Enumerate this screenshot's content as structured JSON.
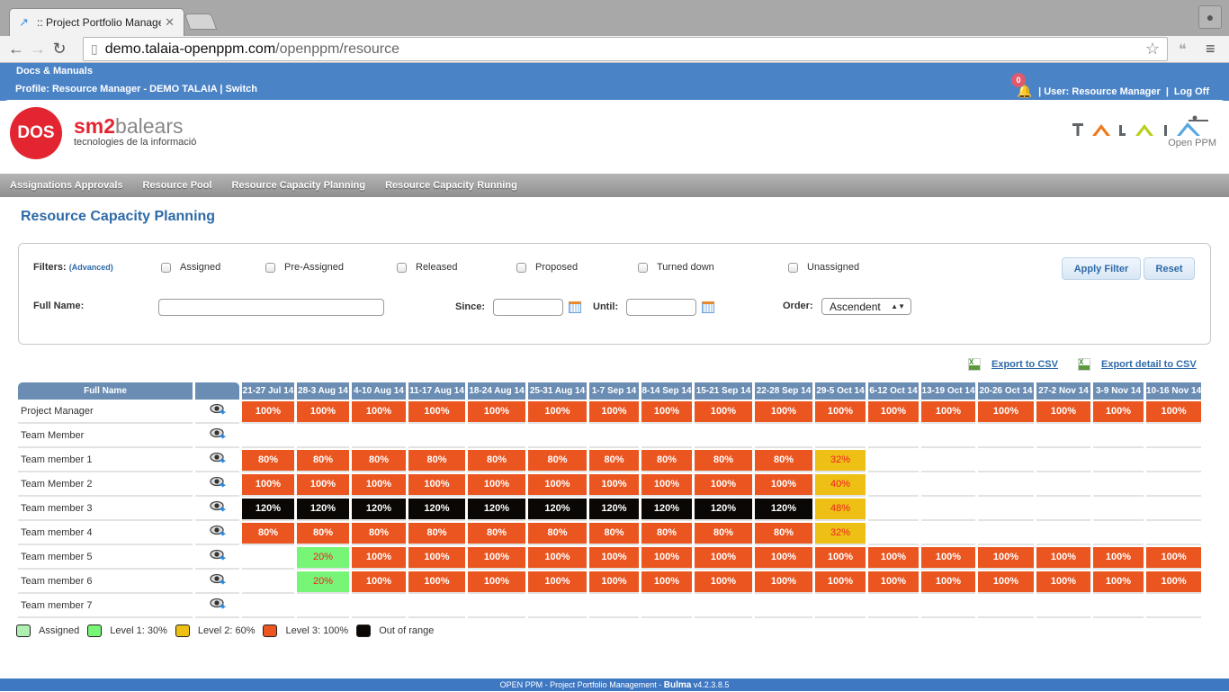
{
  "browser": {
    "tab_title": ":: Project Portfolio Manage",
    "url_host": "demo.talaia-openppm.com",
    "url_path": "/openppm/resource"
  },
  "header": {
    "docs": "Docs & Manuals",
    "profile": "Profile: Resource Manager - DEMO TALAIA | Switch",
    "notification_count": "0",
    "user": "| User: Resource Manager",
    "separator": "|",
    "logoff": "Log Off"
  },
  "logos": {
    "dos": "DOS",
    "sm2_bold": "sm2",
    "sm2_light": "balears",
    "sm2_sub": "tecnologies de la informació",
    "talaia_sub": "Open PPM"
  },
  "menu": [
    "Assignations Approvals",
    "Resource Pool",
    "Resource Capacity Planning",
    "Resource Capacity Running"
  ],
  "page_title": "Resource Capacity Planning",
  "filters": {
    "label": "Filters:",
    "advanced": "(Advanced)",
    "checkboxes": [
      "Assigned",
      "Pre-Assigned",
      "Released",
      "Proposed",
      "Turned down",
      "Unassigned"
    ],
    "full_name_label": "Full Name:",
    "full_name_value": "",
    "since_label": "Since:",
    "since_value": "",
    "until_label": "Until:",
    "until_value": "",
    "order_label": "Order:",
    "order_value": "Ascendent",
    "apply": "Apply Filter",
    "reset": "Reset"
  },
  "exports": {
    "csv": "Export to CSV",
    "detail_csv": "Export detail to CSV"
  },
  "grid": {
    "name_header": "Full Name",
    "weeks": [
      "21-27 Jul 14",
      "28-3 Aug 14",
      "4-10 Aug 14",
      "11-17 Aug 14",
      "18-24 Aug 14",
      "25-31 Aug 14",
      "1-7 Sep 14",
      "8-14 Sep 14",
      "15-21 Sep 14",
      "22-28 Sep 14",
      "29-5 Oct 14",
      "6-12 Oct 14",
      "13-19 Oct 14",
      "20-26 Oct 14",
      "27-2 Nov 14",
      "3-9 Nov 14",
      "10-16 Nov 14"
    ],
    "rows": [
      {
        "name": "Project Manager",
        "cells": [
          "100%",
          "100%",
          "100%",
          "100%",
          "100%",
          "100%",
          "100%",
          "100%",
          "100%",
          "100%",
          "100%",
          "100%",
          "100%",
          "100%",
          "100%",
          "100%",
          "100%"
        ]
      },
      {
        "name": "Team Member",
        "cells": [
          "",
          "",
          "",
          "",
          "",
          "",
          "",
          "",
          "",
          "",
          "",
          "",
          "",
          "",
          "",
          "",
          ""
        ]
      },
      {
        "name": "Team member 1",
        "cells": [
          "80%",
          "80%",
          "80%",
          "80%",
          "80%",
          "80%",
          "80%",
          "80%",
          "80%",
          "80%",
          "32%",
          "",
          "",
          "",
          "",
          "",
          ""
        ]
      },
      {
        "name": "Team Member 2",
        "cells": [
          "100%",
          "100%",
          "100%",
          "100%",
          "100%",
          "100%",
          "100%",
          "100%",
          "100%",
          "100%",
          "40%",
          "",
          "",
          "",
          "",
          "",
          ""
        ]
      },
      {
        "name": "Team member 3",
        "cells": [
          "120%",
          "120%",
          "120%",
          "120%",
          "120%",
          "120%",
          "120%",
          "120%",
          "120%",
          "120%",
          "48%",
          "",
          "",
          "",
          "",
          "",
          ""
        ]
      },
      {
        "name": "Team member 4",
        "cells": [
          "80%",
          "80%",
          "80%",
          "80%",
          "80%",
          "80%",
          "80%",
          "80%",
          "80%",
          "80%",
          "32%",
          "",
          "",
          "",
          "",
          "",
          ""
        ]
      },
      {
        "name": "Team member 5",
        "cells": [
          "",
          "20%",
          "100%",
          "100%",
          "100%",
          "100%",
          "100%",
          "100%",
          "100%",
          "100%",
          "100%",
          "100%",
          "100%",
          "100%",
          "100%",
          "100%",
          "100%"
        ]
      },
      {
        "name": "Team member 6",
        "cells": [
          "",
          "20%",
          "100%",
          "100%",
          "100%",
          "100%",
          "100%",
          "100%",
          "100%",
          "100%",
          "100%",
          "100%",
          "100%",
          "100%",
          "100%",
          "100%",
          "100%"
        ]
      },
      {
        "name": "Team member 7",
        "cells": [
          "",
          "",
          "",
          "",
          "",
          "",
          "",
          "",
          "",
          "",
          "",
          "",
          "",
          "",
          "",
          "",
          ""
        ]
      }
    ]
  },
  "legend": [
    {
      "label": "Assigned",
      "color": "#aef0b0"
    },
    {
      "label": "Level 1: 30%",
      "color": "#77f577"
    },
    {
      "label": "Level 2: 60%",
      "color": "#eebf15"
    },
    {
      "label": "Level 3: 100%",
      "color": "#ea5520"
    },
    {
      "label": "Out of range",
      "color": "#0a0704"
    }
  ],
  "colors": {
    "level1": "#77f577",
    "level2": "#eebf15",
    "level3": "#ea5520",
    "out_of_range": "#0a0704"
  },
  "footer": {
    "text": "OPEN PPM - Project Portfolio Management - ",
    "brand": "Bulma",
    "version": " v4.2.3.8.5"
  }
}
